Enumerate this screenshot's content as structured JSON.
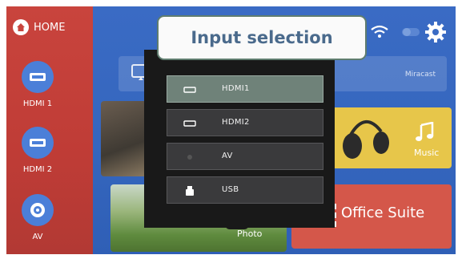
{
  "sidebar": {
    "home_label": "HOME",
    "items": [
      {
        "label": "HDMI 1",
        "icon": "hdmi-port-icon"
      },
      {
        "label": "HDMI 2",
        "icon": "hdmi-port-icon"
      },
      {
        "label": "AV",
        "icon": "av-jack-icon"
      }
    ]
  },
  "status": {
    "icons": [
      "wifi-icon",
      "toggle-icon",
      "gear-icon"
    ]
  },
  "tiles": {
    "miracast_label": "Miracast",
    "music_label": "Music",
    "photo_label": "Photo",
    "office_label": "Office Suite"
  },
  "input_panel": {
    "title": "Input selection",
    "sources": [
      {
        "label": "HDMI1",
        "icon": "hdmi-icon",
        "selected": true
      },
      {
        "label": "HDMI2",
        "icon": "hdmi-icon",
        "selected": false
      },
      {
        "label": "AV",
        "icon": "av-icon",
        "selected": false
      },
      {
        "label": "USB",
        "icon": "usb-icon",
        "selected": false
      }
    ]
  },
  "colors": {
    "sidebar": "#c9443d",
    "screen_bg": "#3a6bc4",
    "panel_bg": "#191919",
    "selected_row": "#6f8279",
    "title_text": "#4a6a8c"
  }
}
